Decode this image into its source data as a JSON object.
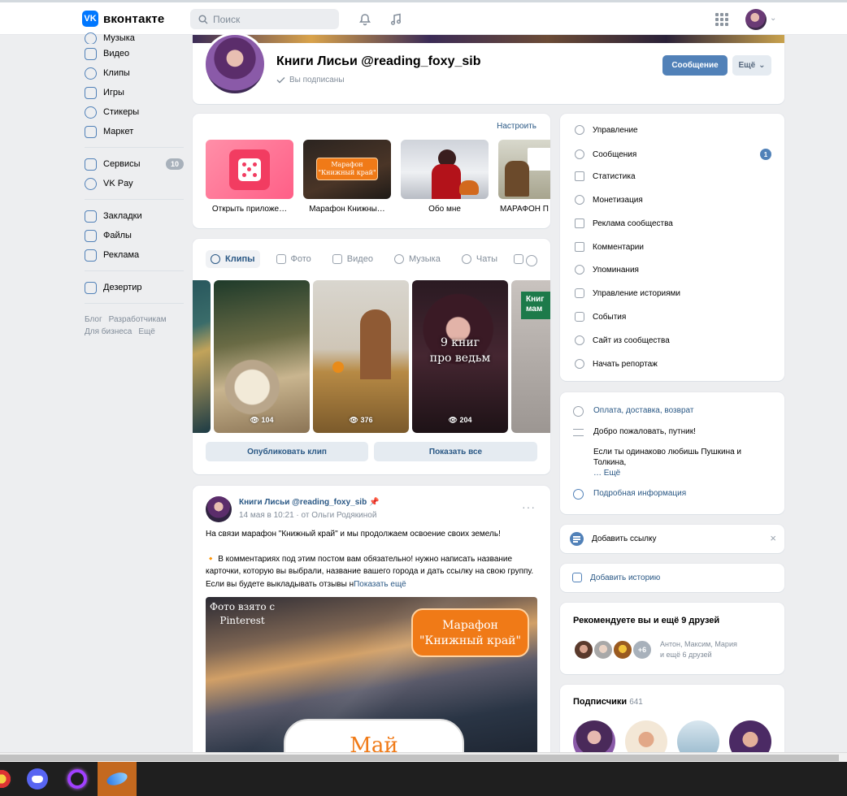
{
  "header": {
    "logo_text": "вконтакте",
    "logo_mark": "VK",
    "search_placeholder": "Поиск"
  },
  "leftnav": {
    "items": [
      {
        "label": "Музыка"
      },
      {
        "label": "Видео"
      },
      {
        "label": "Клипы"
      },
      {
        "label": "Игры"
      },
      {
        "label": "Стикеры"
      },
      {
        "label": "Маркет"
      },
      {
        "label": "Сервисы",
        "badge": "10"
      },
      {
        "label": "VK Pay"
      },
      {
        "label": "Закладки"
      },
      {
        "label": "Файлы"
      },
      {
        "label": "Реклама"
      },
      {
        "label": "Дезертир"
      }
    ],
    "footer": [
      "Блог",
      "Разработчикам",
      "Для бизнеса",
      "Ещё"
    ]
  },
  "profile": {
    "name": "Книги Лисьи @reading_foxy_sib",
    "subscribed": "Вы подписаны",
    "message_button": "Сообщение",
    "more_button": "Ещё"
  },
  "apps": {
    "configure": "Настроить",
    "tiles": [
      {
        "label": "Открыть приложе…"
      },
      {
        "label": "Марафон Книжны…",
        "overlay": "Марафон\n\"Книжный край\""
      },
      {
        "label": "Обо мне"
      },
      {
        "label": "МАРАФОН П"
      }
    ]
  },
  "clips": {
    "tabs": [
      "Клипы",
      "Фото",
      "Видео",
      "Музыка",
      "Чаты"
    ],
    "items": [
      {
        "views": ""
      },
      {
        "views": "104"
      },
      {
        "views": "376"
      },
      {
        "views": "204",
        "caption": "9 книг\nпро ведьм"
      },
      {
        "views": "",
        "caption": "Книг\nмам"
      }
    ],
    "publish_button": "Опубликовать клип",
    "show_all_button": "Показать все"
  },
  "post": {
    "author": "Книги Лисьи @reading_foxy_sib",
    "date": "14 мая в 10:21",
    "from": "от Ольги Родякиной",
    "text_1": "На связи марафон \"Книжный край\" и мы продолжаем освоение своих земель!",
    "text_2": "В комментариях под этим постом вам обязательно! нужно написать название карточки, которую вы выбрали, название вашего города и дать ссылку на свою группу. Если вы будете выкладывать отзывы н",
    "show_more": "Показать ещё",
    "image_caption": "Фото взято с\nPinterest",
    "image_badge": "Марафон\n\"Книжный край\"",
    "image_bottom": "Май"
  },
  "manage": {
    "items": [
      {
        "label": "Управление"
      },
      {
        "label": "Сообщения",
        "badge": "1"
      },
      {
        "label": "Статистика"
      },
      {
        "label": "Монетизация"
      },
      {
        "label": "Реклама сообщества"
      },
      {
        "label": "Комментарии"
      },
      {
        "label": "Упоминания"
      },
      {
        "label": "Управление историями"
      },
      {
        "label": "События"
      },
      {
        "label": "Сайт из сообщества"
      },
      {
        "label": "Начать репортаж"
      }
    ]
  },
  "info": {
    "delivery": "Оплата, доставка, возврат",
    "greeting": "Добро пожаловать, путник!",
    "desc": "Если ты одинаково любишь Пушкина и Толкина,",
    "more": "… Ещё",
    "details": "Подробная информация"
  },
  "addlink": {
    "label": "Добавить ссылку"
  },
  "addhistory": {
    "label": "Добавить историю"
  },
  "recommend": {
    "title": "Рекомендуете вы и ещё 9 друзей",
    "plus": "+6",
    "names": "Антон, Максим, Мария",
    "names_more": "и ещё 6 друзей"
  },
  "subscribers": {
    "title": "Подписчики",
    "count": "641"
  },
  "colors": {
    "accent": "#5181b8",
    "link": "#2a5885",
    "background": "#edeef0"
  }
}
